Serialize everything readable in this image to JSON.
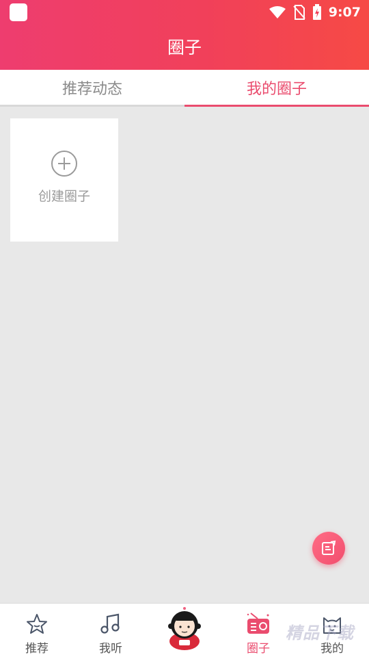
{
  "status_bar": {
    "time": "9:07"
  },
  "header": {
    "title": "圈子"
  },
  "tabs": [
    {
      "label": "推荐动态",
      "active": false
    },
    {
      "label": "我的圈子",
      "active": true
    }
  ],
  "create_card": {
    "icon": "plus-circle-icon",
    "label": "创建圈子"
  },
  "fab": {
    "icon": "edit-note-icon"
  },
  "bottom_nav": [
    {
      "label": "推荐",
      "icon": "star-icon",
      "active": false
    },
    {
      "label": "我听",
      "icon": "music-note-icon",
      "active": false
    },
    {
      "label": "",
      "icon": "mascot-avatar-icon",
      "active": false
    },
    {
      "label": "圈子",
      "icon": "radio-icon",
      "active": true
    },
    {
      "label": "我的",
      "icon": "cat-icon",
      "active": false
    }
  ],
  "watermark": "精品下载",
  "colors": {
    "accent": "#ea4c6e",
    "header_start": "#ee3d6f",
    "header_end": "#f64a45",
    "background": "#e8e8e8"
  }
}
